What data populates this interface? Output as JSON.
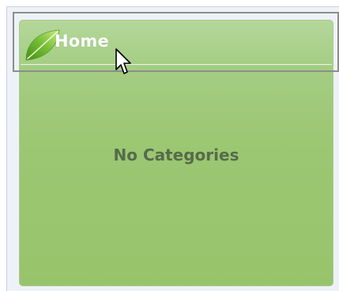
{
  "panel": {
    "title": "Home",
    "empty_message": "No Categories"
  },
  "icons": {
    "title_icon": "leaf-icon",
    "pointer": "mouse-cursor-icon"
  },
  "colors": {
    "panel_top": "#b4d79a",
    "panel_bottom": "#97c46b",
    "title_text": "#ffffff",
    "empty_text": "#566b4a",
    "selection_border": "#8d8d8d"
  }
}
